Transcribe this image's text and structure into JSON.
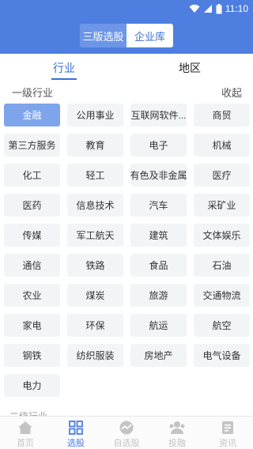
{
  "status": {
    "time": "11:10"
  },
  "header": {
    "seg_left": "三版选股",
    "seg_right": "企业库"
  },
  "tabs": {
    "industry": "行业",
    "region": "地区"
  },
  "section": {
    "title": "一级行业",
    "collapse": "收起"
  },
  "industries": [
    {
      "label": "金融",
      "selected": true
    },
    {
      "label": "公用事业"
    },
    {
      "label": "互联网软件..."
    },
    {
      "label": "商贸"
    },
    {
      "label": "第三方服务"
    },
    {
      "label": "教育"
    },
    {
      "label": "电子"
    },
    {
      "label": "机械"
    },
    {
      "label": "化工"
    },
    {
      "label": "轻工"
    },
    {
      "label": "有色及非金属"
    },
    {
      "label": "医疗"
    },
    {
      "label": "医药"
    },
    {
      "label": "信息技术"
    },
    {
      "label": "汽车"
    },
    {
      "label": "采矿业"
    },
    {
      "label": "传媒"
    },
    {
      "label": "军工航天"
    },
    {
      "label": "建筑"
    },
    {
      "label": "文体娱乐"
    },
    {
      "label": "通信"
    },
    {
      "label": "铁路"
    },
    {
      "label": "食品"
    },
    {
      "label": "石油"
    },
    {
      "label": "农业"
    },
    {
      "label": "煤炭"
    },
    {
      "label": "旅游"
    },
    {
      "label": "交通物流"
    },
    {
      "label": "家电"
    },
    {
      "label": "环保"
    },
    {
      "label": "航运"
    },
    {
      "label": "航空"
    },
    {
      "label": "钢铁"
    },
    {
      "label": "纺织服装"
    },
    {
      "label": "房地产"
    },
    {
      "label": "电气设备"
    },
    {
      "label": "电力"
    }
  ],
  "peek_text": "二级行业",
  "tabbar": {
    "home": "首页",
    "select": "选股",
    "watch": "自选股",
    "invest": "投融",
    "news": "资讯"
  },
  "colors": {
    "primary": "#4d7ee0",
    "chip_selected": "#7ea4ec",
    "chip_bg": "#f3f4f6"
  }
}
